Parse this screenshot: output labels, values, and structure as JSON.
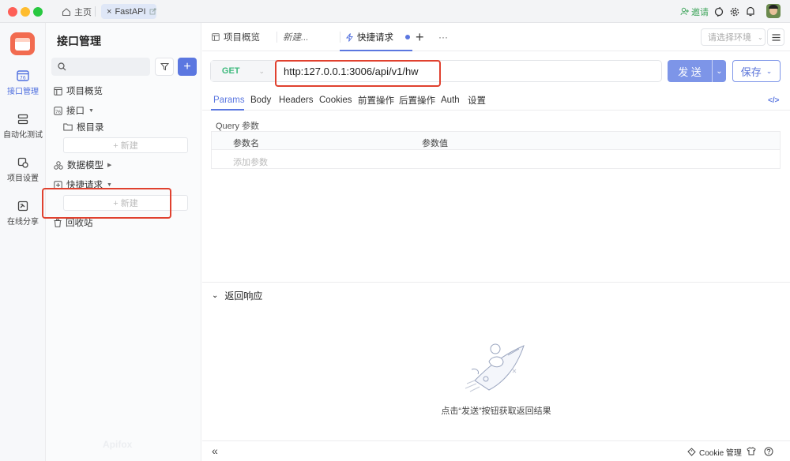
{
  "titlebar": {
    "home": "主页",
    "tab": "FastAPI",
    "tab_close": "×",
    "invite": "邀请"
  },
  "rail": [
    {
      "label": "接口管理"
    },
    {
      "label": "自动化测试"
    },
    {
      "label": "项目设置"
    },
    {
      "label": "在线分享"
    }
  ],
  "sidebar": {
    "title": "接口管理",
    "add": "+",
    "overview": "项目概览",
    "api": "接口",
    "root": "根目录",
    "new": "+ 新建",
    "models": "数据模型",
    "quick": "快捷请求",
    "new2": "+ 新建",
    "trash": "回收站",
    "brand": "Apifox"
  },
  "tabs": {
    "t1": "项目概览",
    "t2": "新建...",
    "t3": "快捷请求",
    "plus": "+",
    "more": "···",
    "env": "请选择环境"
  },
  "request": {
    "method": "GET",
    "url": "http:127.0.0.1:3006/api/v1/hw",
    "send": "发 送",
    "save": "保存"
  },
  "subtabs": [
    "Params",
    "Body",
    "Headers",
    "Cookies",
    "前置操作",
    "后置操作",
    "Auth",
    "设置"
  ],
  "params": {
    "section": "Query 参数",
    "col_name": "参数名",
    "col_value": "参数值",
    "add": "添加参数"
  },
  "response": {
    "title": "返回响应",
    "hint": "点击“发送”按钮获取返回结果"
  },
  "footer": {
    "cookie": "Cookie 管理",
    "collapse": "«"
  },
  "colors": {
    "accent": "#5b77e0",
    "red": "#e0412f",
    "get": "#3fba7e"
  }
}
